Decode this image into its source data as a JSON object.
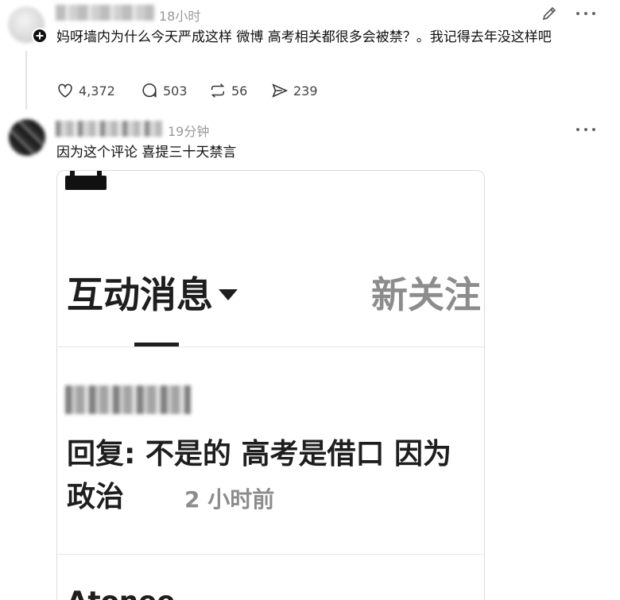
{
  "post": {
    "time": "18小时",
    "text": "妈呀墙内为什么今天严成这样 微博 高考相关都很多会被禁？。我记得去年没这样吧",
    "stats": {
      "likes": "4,372",
      "replies": "503",
      "reposts": "56",
      "shares": "239"
    }
  },
  "reply": {
    "time": "19分钟",
    "text": "因为这个评论 喜提三十天禁言",
    "screenshot": {
      "tab_active": "互动消息",
      "tab_next": "新关注",
      "message_text": "回复: 不是的 高考是借口 因为政治",
      "message_time": "2 小时前",
      "next_preview": "Atonee"
    }
  },
  "icons": {
    "edit": "pencil-icon",
    "more": "more-icon",
    "like": "heart-icon",
    "reply": "comment-icon",
    "repost": "repost-icon",
    "share": "send-icon",
    "follow": "plus-circle-icon"
  }
}
